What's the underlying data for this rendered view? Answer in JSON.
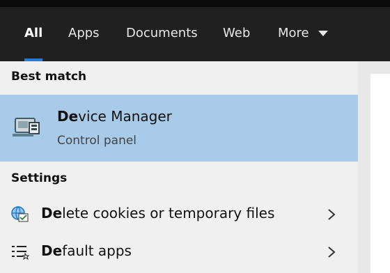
{
  "tabs": [
    {
      "label": "All",
      "active": true
    },
    {
      "label": "Apps"
    },
    {
      "label": "Documents"
    },
    {
      "label": "Web"
    },
    {
      "label": "More"
    }
  ],
  "best_match": {
    "section_label": "Best match",
    "title_bold": "De",
    "title_rest": "vice Manager",
    "subtitle": "Control panel",
    "icon": "device-manager-icon"
  },
  "settings": {
    "section_label": "Settings",
    "items": [
      {
        "label_bold": "De",
        "label_rest": "lete cookies or temporary files",
        "icon": "internet-options-icon"
      },
      {
        "label_bold": "De",
        "label_rest": "fault apps",
        "icon": "default-apps-icon"
      }
    ]
  },
  "colors": {
    "accent": "#2b7bd3",
    "selected": "#a7cbe9",
    "tabbar": "#202020",
    "results_bg": "#f0f0f0"
  }
}
